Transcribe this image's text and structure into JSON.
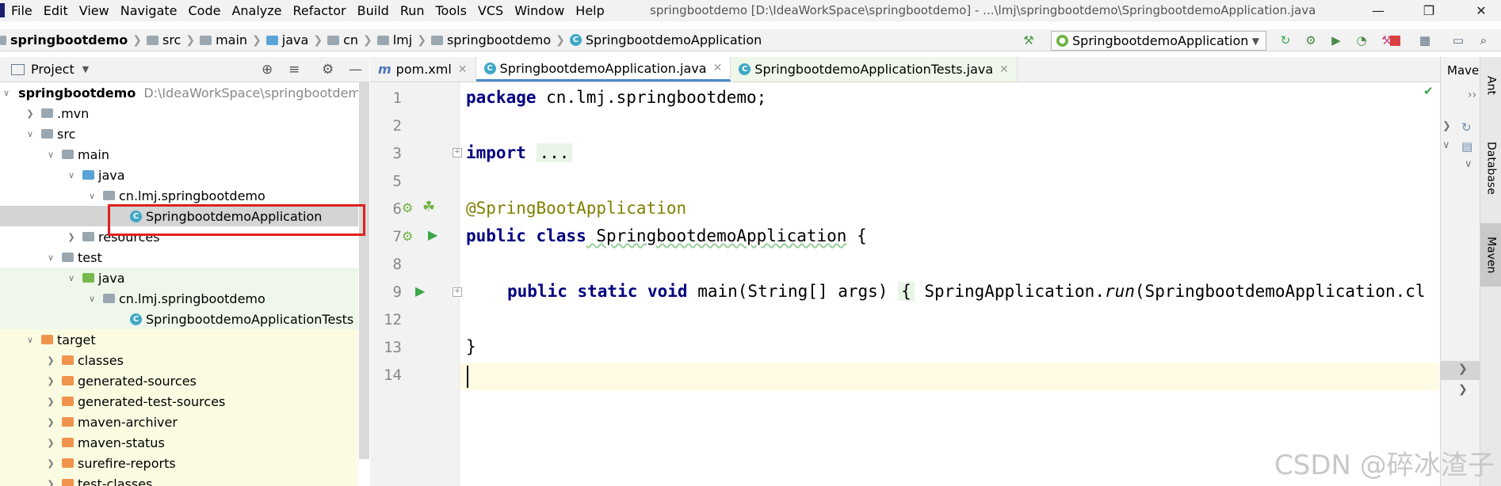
{
  "menu": {
    "items": [
      "File",
      "Edit",
      "View",
      "Navigate",
      "Code",
      "Analyze",
      "Refactor",
      "Build",
      "Run",
      "Tools",
      "VCS",
      "Window",
      "Help"
    ]
  },
  "window_title": "springbootdemo [D:\\IdeaWorkSpace\\springbootdemo] - ...\\lmj\\springbootdemo\\SpringbootdemoApplication.java",
  "breadcrumbs": [
    "springbootdemo",
    "src",
    "main",
    "java",
    "cn",
    "lmj",
    "springbootdemo",
    "SpringbootdemoApplication"
  ],
  "toolbar": {
    "run_config": "SpringbootdemoApplication"
  },
  "project_panel": {
    "title": "Project",
    "tree": [
      {
        "label": "springbootdemo",
        "path": "D:\\IdeaWorkSpace\\springbootdemo"
      },
      {
        "label": ".mvn"
      },
      {
        "label": "src"
      },
      {
        "label": "main"
      },
      {
        "label": "java"
      },
      {
        "label": "cn.lmj.springbootdemo"
      },
      {
        "label": "SpringbootdemoApplication"
      },
      {
        "label": "resources"
      },
      {
        "label": "test"
      },
      {
        "label": "java"
      },
      {
        "label": "cn.lmj.springbootdemo"
      },
      {
        "label": "SpringbootdemoApplicationTests"
      },
      {
        "label": "target"
      },
      {
        "label": "classes"
      },
      {
        "label": "generated-sources"
      },
      {
        "label": "generated-test-sources"
      },
      {
        "label": "maven-archiver"
      },
      {
        "label": "maven-status"
      },
      {
        "label": "surefire-reports"
      },
      {
        "label": "test-classes"
      }
    ]
  },
  "editor": {
    "tabs": [
      {
        "label": "pom.xml",
        "icon": "m"
      },
      {
        "label": "SpringbootdemoApplication.java",
        "icon": "C"
      },
      {
        "label": "SpringbootdemoApplicationTests.java",
        "icon": "C"
      }
    ],
    "line_numbers": [
      "1",
      "2",
      "3",
      "5",
      "6",
      "7",
      "8",
      "9",
      "12",
      "13",
      "14"
    ],
    "code": {
      "l1_kw": "package",
      "l1_rest": " cn.lmj.springbootdemo;",
      "l3_kw": "import",
      "l3_fold": "...",
      "l6_ann": "@SpringBootApplication",
      "l7_kw": "public class",
      "l7_name": " SpringbootdemoApplication",
      "l7_rest": " {",
      "l9_kw": "public static void",
      "l9_rest": " main(String[] args) ",
      "l9_brace": "{",
      "l9_call1": " SpringApplication.",
      "l9_run": "run",
      "l9_call2": "(SpringbootdemoApplication.cl",
      "l13": "}"
    }
  },
  "right_panel": {
    "maven_title": "Maven",
    "tabs": [
      "Ant",
      "Database",
      "Maven"
    ]
  },
  "watermark": "CSDN @碎冰渣子"
}
